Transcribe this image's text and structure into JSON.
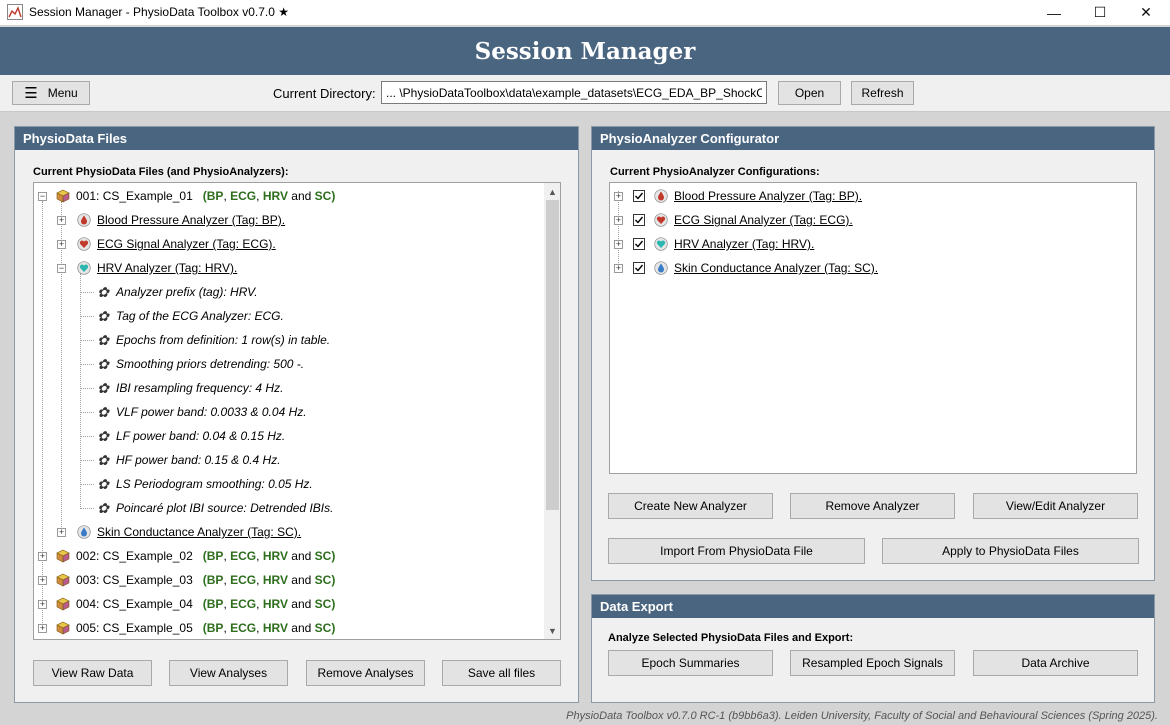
{
  "window": {
    "title": "Session Manager - PhysioData Toolbox v0.7.0 ★",
    "minimize": "—",
    "maximize": "☐",
    "close": "✕"
  },
  "header": {
    "title": "Session Manager"
  },
  "toolbar": {
    "menu_label": "Menu",
    "dir_label": "Current Directory:",
    "dir_value": "... \\PhysioDataToolbox\\data\\example_datasets\\ECG_EDA_BP_ShockCS\\",
    "open_label": "Open",
    "refresh_label": "Refresh"
  },
  "files_panel": {
    "title": "PhysioData Files",
    "subtitle": "Current PhysioData Files (and PhysioAnalyzers):",
    "tree": {
      "file1": {
        "name": "001: CS_Example_01",
        "open": "(",
        "bp": "BP",
        "c1": ",",
        "ecg": "ECG",
        "c2": ",",
        "hrv": "HRV",
        "and": "and",
        "sc": "SC",
        "close": ")"
      },
      "analyzers": [
        {
          "label": "Blood Pressure Analyzer (Tag: BP).",
          "icon": "blood-drop-icon"
        },
        {
          "label": "ECG Signal Analyzer (Tag: ECG).",
          "icon": "heart-icon"
        },
        {
          "label": "HRV Analyzer (Tag: HRV).",
          "icon": "cyan-heart-icon"
        },
        {
          "label": "Skin Conductance Analyzer (Tag: SC).",
          "icon": "water-drop-icon"
        }
      ],
      "hrv_settings": [
        "Analyzer prefix (tag): HRV.",
        "Tag of the ECG Analyzer: ECG.",
        "Epochs from definition: 1 row(s) in table.",
        "Smoothing priors detrending: 500 -.",
        "IBI resampling frequency: 4 Hz.",
        "VLF power band: 0.0033 & 0.04 Hz.",
        "LF power band: 0.04 & 0.15 Hz.",
        "HF power band: 0.15 & 0.4 Hz.",
        "LS Periodogram smoothing: 0.05 Hz.",
        "Poincaré plot IBI source: Detrended IBIs."
      ],
      "other_files": [
        {
          "name": "002: CS_Example_02",
          "open": "(",
          "bp": "BP",
          "c1": ",",
          "ecg": "ECG",
          "c2": ",",
          "hrv": "HRV",
          "and": "and",
          "sc": "SC",
          "close": ")"
        },
        {
          "name": "003: CS_Example_03",
          "open": "(",
          "bp": "BP",
          "c1": ",",
          "ecg": "ECG",
          "c2": ",",
          "hrv": "HRV",
          "and": "and",
          "sc": "SC",
          "close": ")"
        },
        {
          "name": "004: CS_Example_04",
          "open": "(",
          "bp": "BP",
          "c1": ",",
          "ecg": "ECG",
          "c2": ",",
          "hrv": "HRV",
          "and": "and",
          "sc": "SC",
          "close": ")"
        },
        {
          "name": "005: CS_Example_05",
          "open": "(",
          "bp": "BP",
          "c1": ",",
          "ecg": "ECG",
          "c2": ",",
          "hrv": "HRV",
          "and": "and",
          "sc": "SC",
          "close": ")"
        }
      ]
    },
    "buttons": {
      "view_raw": "View Raw Data",
      "view_analyses": "View Analyses",
      "remove_analyses": "Remove Analyses",
      "save_all": "Save all files"
    }
  },
  "configurator": {
    "title": "PhysioAnalyzer Configurator",
    "subtitle": "Current PhysioAnalyzer Configurations:",
    "items": [
      {
        "label": "Blood Pressure Analyzer (Tag: BP).",
        "checked": true,
        "icon": "blood-drop-icon"
      },
      {
        "label": "ECG Signal Analyzer (Tag: ECG).",
        "checked": true,
        "icon": "heart-icon"
      },
      {
        "label": "HRV Analyzer (Tag: HRV).",
        "checked": true,
        "icon": "cyan-heart-icon"
      },
      {
        "label": "Skin Conductance Analyzer (Tag: SC).",
        "checked": true,
        "icon": "water-drop-icon"
      }
    ],
    "buttons": {
      "create": "Create New Analyzer",
      "remove": "Remove Analyzer",
      "view_edit": "View/Edit Analyzer",
      "import": "Import From PhysioData File",
      "apply": "Apply to PhysioData Files"
    }
  },
  "export": {
    "title": "Data Export",
    "subtitle": "Analyze Selected PhysioData Files and Export:",
    "buttons": {
      "epoch_summaries": "Epoch Summaries",
      "resampled": "Resampled Epoch Signals",
      "archive": "Data Archive"
    }
  },
  "footer": {
    "text": "PhysioData Toolbox v0.7.0 RC-1 (b9bb6a3). Leiden University, Faculty of Social and Behavioural Sciences (Spring 2025)."
  },
  "colors": {
    "header_bg": "#4a6580",
    "tag_green": "#2e6e1e",
    "panel_bg": "#f0f0f0"
  }
}
